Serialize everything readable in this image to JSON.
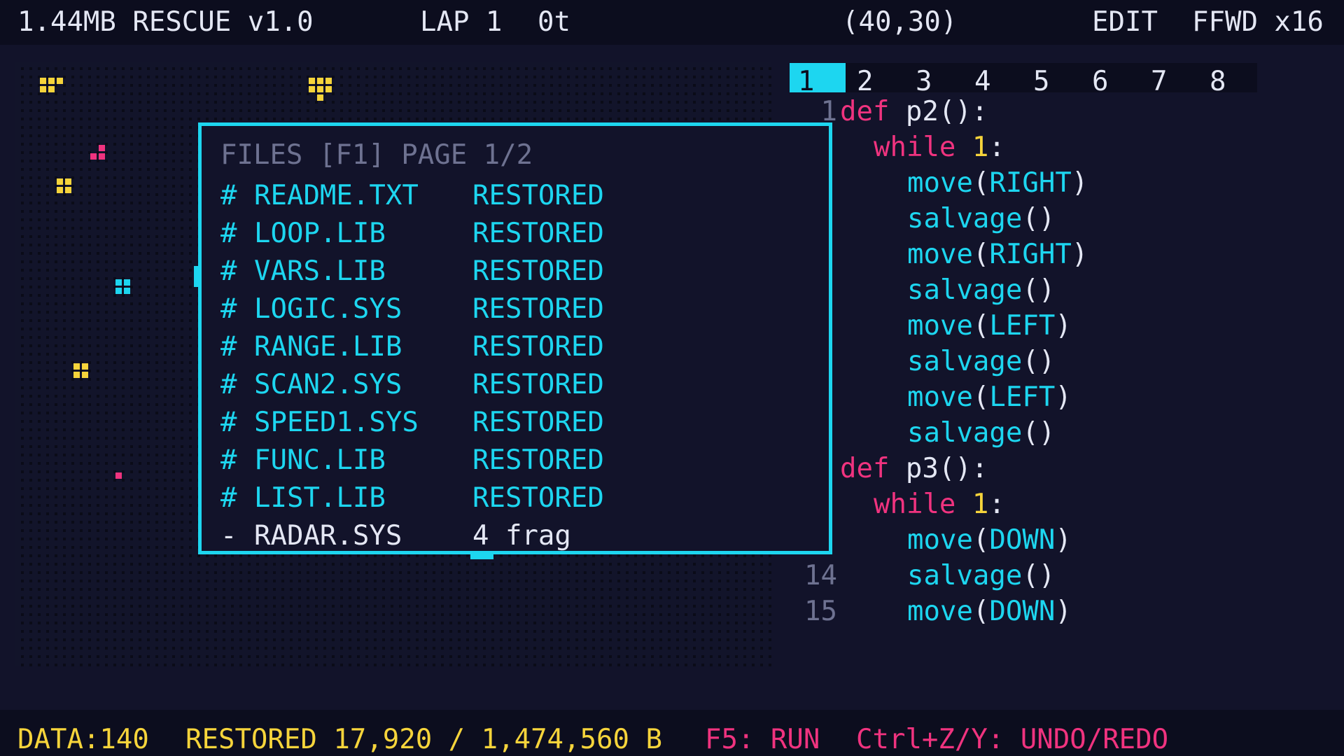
{
  "header": {
    "title": "1.44MB RESCUE v1.0",
    "lap": "LAP 1",
    "ticks": "0t",
    "coords": "(40,30)",
    "mode": "EDIT",
    "speed": "FFWD x16"
  },
  "colors": {
    "cyan": "#1dd6f0",
    "yellow": "#f6d43b",
    "pink": "#f0337f",
    "text": "#e4e7f4",
    "dim": "#6e7291",
    "background": "#12132a"
  },
  "files_dialog": {
    "title": "FILES [F1] PAGE 1/2",
    "files": [
      {
        "marker": "#",
        "name": "README.TXT",
        "status": "RESTORED"
      },
      {
        "marker": "#",
        "name": "LOOP.LIB",
        "status": "RESTORED"
      },
      {
        "marker": "#",
        "name": "VARS.LIB",
        "status": "RESTORED"
      },
      {
        "marker": "#",
        "name": "LOGIC.SYS",
        "status": "RESTORED"
      },
      {
        "marker": "#",
        "name": "RANGE.LIB",
        "status": "RESTORED"
      },
      {
        "marker": "#",
        "name": "SCAN2.SYS",
        "status": "RESTORED"
      },
      {
        "marker": "#",
        "name": "SPEED1.SYS",
        "status": "RESTORED"
      },
      {
        "marker": "#",
        "name": "FUNC.LIB",
        "status": "RESTORED"
      },
      {
        "marker": "#",
        "name": "LIST.LIB",
        "status": "RESTORED"
      },
      {
        "marker": "-",
        "name": "RADAR.SYS",
        "status": "4 frag"
      }
    ]
  },
  "editor": {
    "tabs": [
      "1",
      "2",
      "3",
      "4",
      "5",
      "6",
      "7",
      "8"
    ],
    "active_tab": "1",
    "visible_line_numbers": [
      "1",
      "14",
      "15"
    ],
    "lines": [
      {
        "keyword": "def",
        "name": " p2",
        "rest": "():"
      },
      {
        "keyword": "while",
        "number": "1",
        "rest": ":"
      },
      {
        "func": "move",
        "arg": "RIGHT"
      },
      {
        "func": "salvage",
        "arg": ""
      },
      {
        "func": "move",
        "arg": "RIGHT"
      },
      {
        "func": "salvage",
        "arg": ""
      },
      {
        "func": "move",
        "arg": "LEFT"
      },
      {
        "func": "salvage",
        "arg": ""
      },
      {
        "func": "move",
        "arg": "LEFT"
      },
      {
        "func": "salvage",
        "arg": ""
      },
      {
        "keyword": "def",
        "name": " p3",
        "rest": "():"
      },
      {
        "keyword": "while",
        "number": "1",
        "rest": ":"
      },
      {
        "func": "move",
        "arg": "DOWN"
      },
      {
        "func": "salvage",
        "arg": ""
      },
      {
        "func": "move",
        "arg": "DOWN"
      }
    ]
  },
  "status_bar": {
    "data": "DATA:140",
    "restored": "RESTORED 17,920 / 1,474,560 B",
    "run_hint": "F5: RUN",
    "undo_hint": "Ctrl+Z/Y: UNDO/REDO"
  }
}
